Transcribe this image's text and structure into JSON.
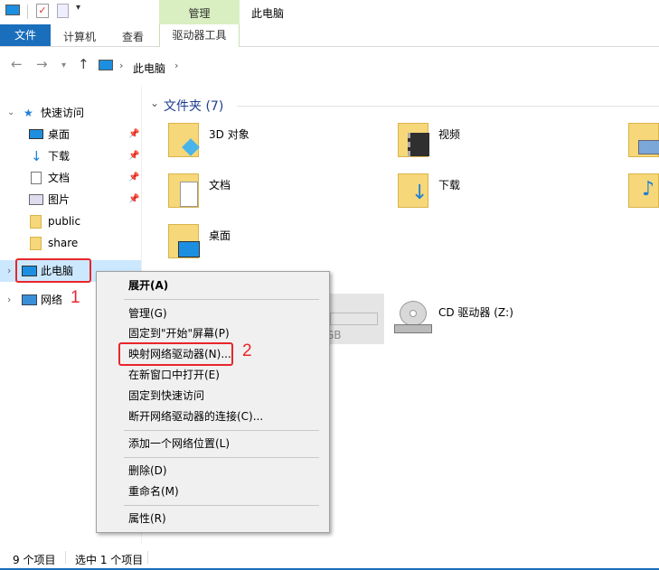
{
  "window": {
    "title": "此电脑",
    "context_tab_group": "管理"
  },
  "ribbon": {
    "tabs": [
      "文件",
      "计算机",
      "查看",
      "驱动器工具"
    ]
  },
  "address": {
    "path": "此电脑"
  },
  "sidebar": {
    "quick_access": "快速访问",
    "items": [
      {
        "label": "桌面"
      },
      {
        "label": "下载"
      },
      {
        "label": "文档"
      },
      {
        "label": "图片"
      },
      {
        "label": "public"
      },
      {
        "label": "share"
      }
    ],
    "this_pc": "此电脑",
    "network": "网络"
  },
  "content": {
    "folders_header": "文件夹 (7)",
    "folders": [
      "3D 对象",
      "视频",
      "文档",
      "下载",
      "桌面"
    ],
    "drive_label": "CD 驱动器 (Z:)",
    "drive_partial": "GB"
  },
  "context_menu": {
    "items": [
      "展开(A)",
      "管理(G)",
      "固定到\"开始\"屏幕(P)",
      "映射网络驱动器(N)...",
      "在新窗口中打开(E)",
      "固定到快速访问",
      "断开网络驱动器的连接(C)...",
      "添加一个网络位置(L)",
      "删除(D)",
      "重命名(M)",
      "属性(R)"
    ]
  },
  "annotations": {
    "step1": "1",
    "step2": "2"
  },
  "status": {
    "count": "9 个项目",
    "selected": "选中 1 个项目"
  },
  "colors": {
    "file_tab": "#1a6fbd",
    "manage_band": "#d9efc2",
    "annotation": "#e8262b",
    "header_text": "#1e3c8f"
  }
}
